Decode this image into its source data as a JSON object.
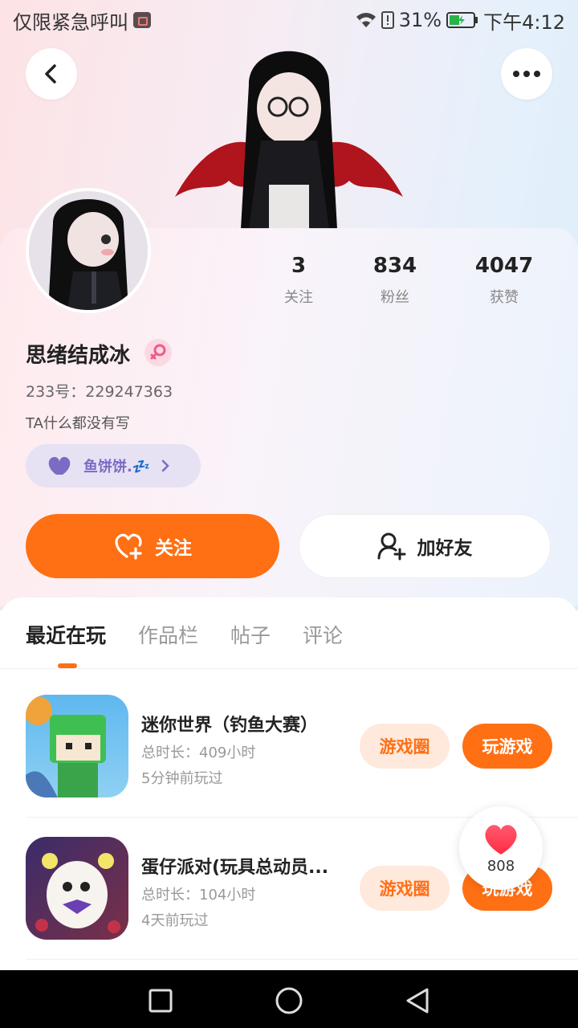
{
  "status_bar": {
    "left_text": "仅限紧急呼叫",
    "battery": "31%",
    "time": "下午4:12"
  },
  "profile": {
    "username": "思绪结成冰",
    "id_text": "233号：229247363",
    "bio": "TA什么都没有写",
    "pet_name": "鱼饼饼.💤",
    "stats": [
      {
        "value": "3",
        "label": "关注"
      },
      {
        "value": "834",
        "label": "粉丝"
      },
      {
        "value": "4047",
        "label": "获赞"
      }
    ]
  },
  "actions": {
    "follow": "关注",
    "add_friend": "加好友"
  },
  "tabs": [
    {
      "label": "最近在玩",
      "active": true
    },
    {
      "label": "作品栏",
      "active": false
    },
    {
      "label": "帖子",
      "active": false
    },
    {
      "label": "评论",
      "active": false
    }
  ],
  "games": [
    {
      "title": "迷你世界（钓鱼大赛）",
      "duration": "总时长：409小时",
      "last_played": "5分钟前玩过",
      "circle_label": "游戏圈",
      "play_label": "玩游戏"
    },
    {
      "title": "蛋仔派对(玩具总动员...",
      "duration": "总时长：104小时",
      "last_played": "4天前玩过",
      "circle_label": "游戏圈",
      "play_label": "玩游戏"
    }
  ],
  "like_fab": {
    "count": "808"
  },
  "colors": {
    "accent": "#ff6f14",
    "accent_light": "#ffe9dc",
    "pet_chip": "#e7e1f4",
    "pet_text": "#7a6cc4"
  },
  "icons": {
    "back": "chevron-left-icon",
    "more": "more-dots-icon",
    "gender": "female-icon",
    "follow": "heart-plus-icon",
    "add_friend": "user-plus-icon",
    "like": "heart-icon"
  }
}
